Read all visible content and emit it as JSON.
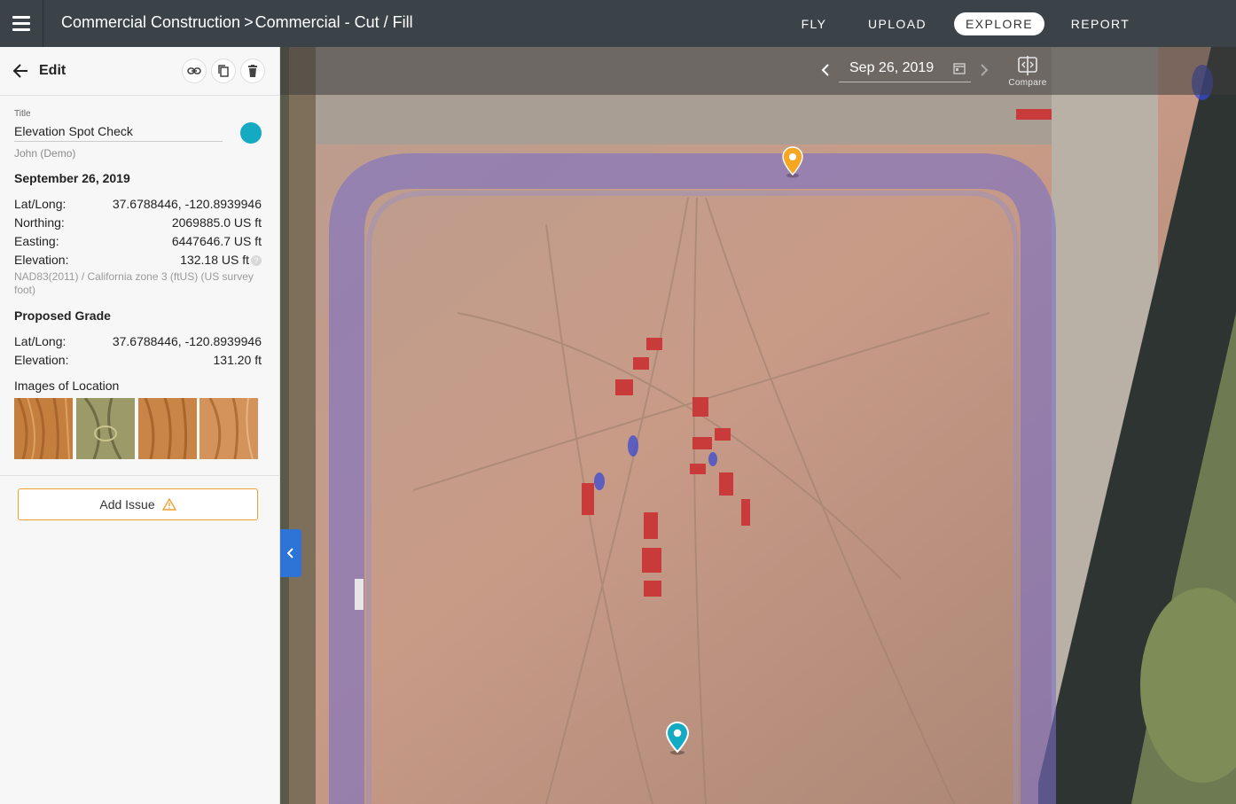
{
  "header": {
    "menu_icon": "hamburger-icon",
    "breadcrumb": {
      "project": "Commercial Construction",
      "separator": ">",
      "layer": "Commercial - Cut / Fill"
    },
    "nav": [
      {
        "label": "FLY",
        "active": false
      },
      {
        "label": "UPLOAD",
        "active": false
      },
      {
        "label": "EXPLORE",
        "active": true
      },
      {
        "label": "REPORT",
        "active": false
      }
    ]
  },
  "panel": {
    "title": "Edit",
    "icons": [
      "arrow-left-icon",
      "link-icon",
      "copy-icon",
      "trash-icon"
    ],
    "title_field": {
      "label": "Title",
      "value": "Elevation Spot Check",
      "color": "#14aac2"
    },
    "author": "John (Demo)",
    "date_heading": "September 26, 2019",
    "measurements": [
      {
        "key": "Lat/Long:",
        "value": "37.6788446, -120.8939946"
      },
      {
        "key": "Northing:",
        "value": "2069885.0 US ft"
      },
      {
        "key": "Easting:",
        "value": "6447646.7 US ft"
      },
      {
        "key": "Elevation:",
        "value": "132.18 US ft"
      }
    ],
    "help_glyph": "?",
    "crs": "NAD83(2011) / California zone 3 (ftUS) (US survey foot)",
    "proposed_heading": "Proposed Grade",
    "proposed": [
      {
        "key": "Lat/Long:",
        "value": "37.6788446, -120.8939946"
      },
      {
        "key": "Elevation:",
        "value": "131.20 ft"
      }
    ],
    "images_label": "Images of Location",
    "add_issue": "Add Issue"
  },
  "map": {
    "date": "Sep 26, 2019",
    "compare_label": "Compare",
    "pin_colors": {
      "selected": "#14aac2",
      "other": "#f5a623"
    },
    "accent": "#2e74d6"
  }
}
